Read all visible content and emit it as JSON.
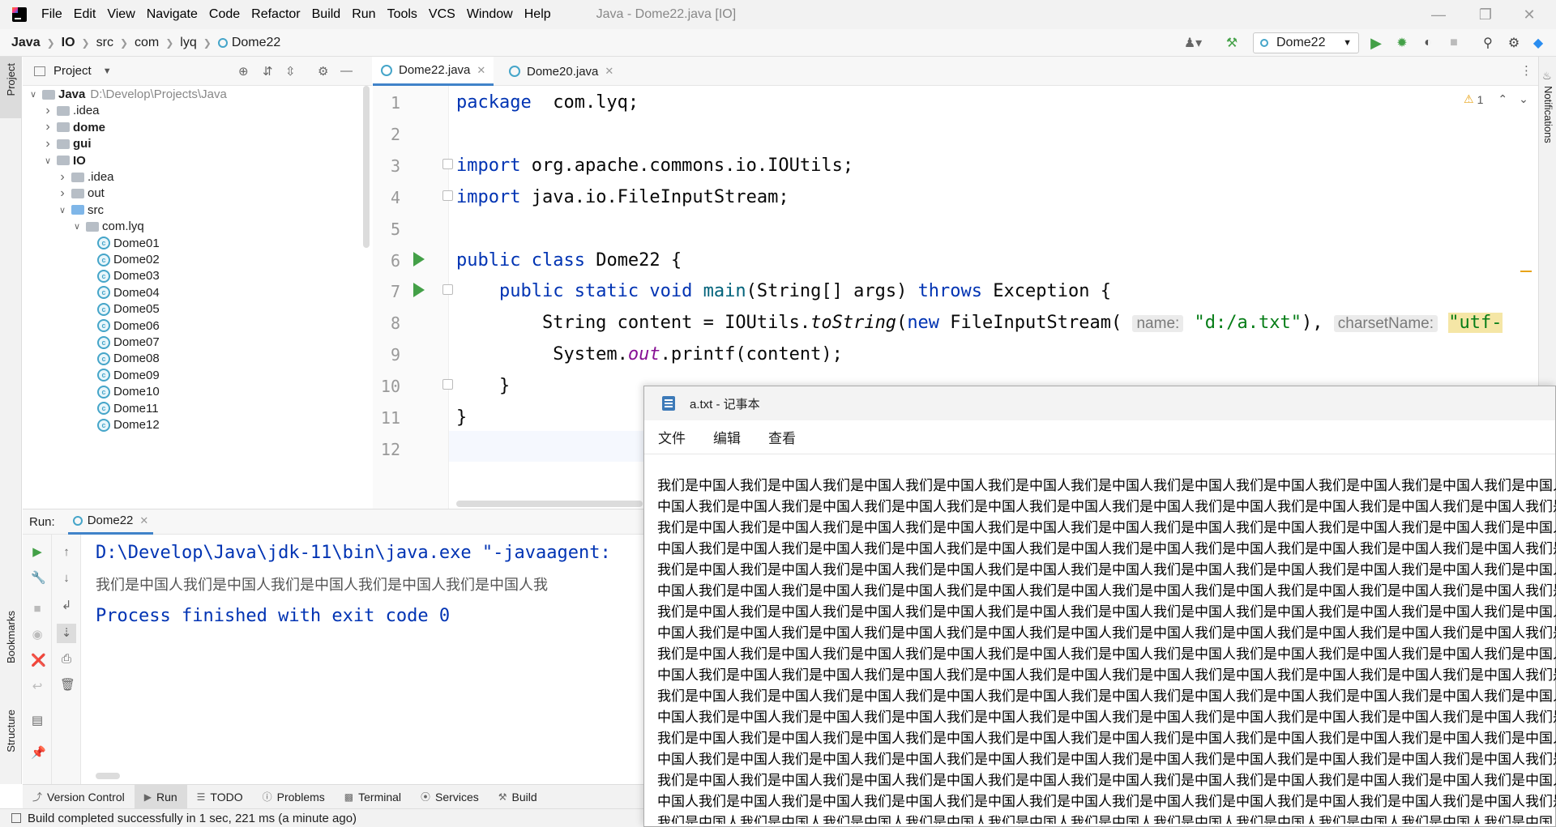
{
  "window": {
    "title": "Java - Dome22.java [IO]"
  },
  "menu": [
    "File",
    "Edit",
    "View",
    "Navigate",
    "Code",
    "Refactor",
    "Build",
    "Run",
    "Tools",
    "VCS",
    "Window",
    "Help"
  ],
  "breadcrumb": [
    "Java",
    "IO",
    "src",
    "com",
    "lyq",
    "Dome22"
  ],
  "run_config": "Dome22",
  "project_panel": {
    "title": "Project"
  },
  "tree": [
    {
      "label": "Java",
      "suffix": "D:\\Develop\\Projects\\Java",
      "depth": 0,
      "kind": "root",
      "open": true,
      "bold": true
    },
    {
      "label": ".idea",
      "depth": 1,
      "kind": "folder"
    },
    {
      "label": "dome",
      "depth": 1,
      "kind": "module",
      "bold": true
    },
    {
      "label": "gui",
      "depth": 1,
      "kind": "module",
      "bold": true
    },
    {
      "label": "IO",
      "depth": 1,
      "kind": "module",
      "open": true,
      "bold": true
    },
    {
      "label": ".idea",
      "depth": 2,
      "kind": "folder"
    },
    {
      "label": "out",
      "depth": 2,
      "kind": "folder"
    },
    {
      "label": "src",
      "depth": 2,
      "kind": "src",
      "open": true
    },
    {
      "label": "com.lyq",
      "depth": 3,
      "kind": "package",
      "open": true
    },
    {
      "label": "Dome01",
      "depth": 4,
      "kind": "class"
    },
    {
      "label": "Dome02",
      "depth": 4,
      "kind": "class"
    },
    {
      "label": "Dome03",
      "depth": 4,
      "kind": "class"
    },
    {
      "label": "Dome04",
      "depth": 4,
      "kind": "class"
    },
    {
      "label": "Dome05",
      "depth": 4,
      "kind": "class"
    },
    {
      "label": "Dome06",
      "depth": 4,
      "kind": "class"
    },
    {
      "label": "Dome07",
      "depth": 4,
      "kind": "class"
    },
    {
      "label": "Dome08",
      "depth": 4,
      "kind": "class"
    },
    {
      "label": "Dome09",
      "depth": 4,
      "kind": "class"
    },
    {
      "label": "Dome10",
      "depth": 4,
      "kind": "class"
    },
    {
      "label": "Dome11",
      "depth": 4,
      "kind": "class"
    },
    {
      "label": "Dome12",
      "depth": 4,
      "kind": "class"
    }
  ],
  "editor_tabs": [
    {
      "label": "Dome22.java",
      "active": true
    },
    {
      "label": "Dome20.java",
      "active": false
    }
  ],
  "editor": {
    "warnings": "1",
    "line_numbers": [
      "1",
      "2",
      "3",
      "4",
      "5",
      "6",
      "7",
      "8",
      "9",
      "10",
      "11",
      "12"
    ],
    "lines": [
      {
        "tokens": [
          [
            "kw",
            "package"
          ],
          [
            "",
            "  com.lyq;"
          ]
        ]
      },
      {
        "tokens": []
      },
      {
        "tokens": [
          [
            "kw",
            "import"
          ],
          [
            "",
            " org.apache.commons.io.IOUtils;"
          ]
        ]
      },
      {
        "tokens": [
          [
            "kw",
            "import"
          ],
          [
            "",
            " java.io.FileInputStream;"
          ]
        ]
      },
      {
        "tokens": []
      },
      {
        "tokens": [
          [
            "kw",
            "public class"
          ],
          [
            "",
            " Dome22 {"
          ]
        ]
      },
      {
        "tokens": [
          [
            "",
            "    "
          ],
          [
            "kw",
            "public static void"
          ],
          [
            "",
            " "
          ],
          [
            "fn",
            "main"
          ],
          [
            "",
            "(String[] args) "
          ],
          [
            "kw",
            "throws"
          ],
          [
            "",
            " Exception {"
          ]
        ]
      },
      {
        "tokens": [
          [
            "",
            "        String content = IOUtils."
          ],
          [
            "it",
            "toString"
          ],
          [
            "",
            "("
          ],
          [
            "kw",
            "new"
          ],
          [
            "",
            " FileInputStream( "
          ],
          [
            "hint",
            "name:"
          ],
          [
            "",
            " "
          ],
          [
            "str",
            "\"d:/a.txt\""
          ],
          [
            "",
            "), "
          ],
          [
            "hint",
            "charsetName:"
          ],
          [
            "",
            " "
          ],
          [
            "strhl",
            "\"utf-"
          ]
        ]
      },
      {
        "tokens": [
          [
            "",
            "         System."
          ],
          [
            "itp",
            "out"
          ],
          [
            "",
            ".printf(content);"
          ]
        ]
      },
      {
        "tokens": [
          [
            "",
            "    }"
          ]
        ]
      },
      {
        "tokens": [
          [
            "",
            "}"
          ]
        ]
      },
      {
        "tokens": []
      }
    ]
  },
  "run_panel": {
    "label": "Run:",
    "tab": "Dome22",
    "console": [
      "D:\\Develop\\Java\\jdk-11\\bin\\java.exe \"-javaagent:",
      "我们是中国人我们是中国人我们是中国人我们是中国人我们是中国人我",
      "Process finished with exit code 0"
    ]
  },
  "bottom_tabs": [
    "Version Control",
    "Run",
    "TODO",
    "Problems",
    "Terminal",
    "Services",
    "Build"
  ],
  "left_strip": [
    "Project",
    "Bookmarks",
    "Structure"
  ],
  "right_strip": [
    "Notifications"
  ],
  "status": "Build completed successfully in 1 sec, 221 ms (a minute ago)",
  "notepad": {
    "title": "a.txt - 记事本",
    "menu": [
      "文件",
      "编辑",
      "查看"
    ],
    "lines": [
      "我们是中国人我们是中国人我们是中国人我们是中国人我们是中国人我们是中国人我们是中国人我们是中国人我们是中国人我们是中国人我们是中国人我们是中国人我们是中国人我们是中国人我们是中国人我们是中国人我们是中国人我们是中国人我们是中国人我们是中国人我们是中国人我们是中国人我们是中国人我们是中国人",
      "中国人我们是中国人我们是中国人我们是中国人我们是中国人我们是中国人我们是中国人我们是中国人我们是中国人我们是中国人我们是中国人我们是中国人我们是中国人我们是中国人我们是中国人我们是中国人我们是中国人我们是中国人我们是中国人我们是中国人我们是中国人我们是中国人我们是中国人我们是中国人",
      "我们是中国人我们是中国人我们是中国人我们是中国人我们是中国人我们是中国人我们是中国人我们是中国人我们是中国人我们是中国人我们是中国人我们是中国人我们是中国人我们是中国人我们是中国人我们是中国人我们是中国人我们是中国人我们是中国人我们是中国人我们是中国人我们是中国人我们是中国人我们是中国人",
      "中国人我们是中国人我们是中国人我们是中国人我们是中国人我们是中国人我们是中国人我们是中国人我们是中国人我们是中国人我们是中国人我们是中国人我们是中国人我们是中国人我们是中国人我们是中国人我们是中国人我们是中国人我们是中国人我们是中国人我们是中国人我们是中国人我们是中国人我们是中国人",
      "我们是中国人我们是中国人我们是中国人我们是中国人我们是中国人我们是中国人我们是中国人我们是中国人我们是中国人我们是中国人我们是中国人我们是中国人我们是中国人我们是中国人我们是中国人我们是中国人我们是中国人我们是中国人我们是中国人我们是中国人我们是中国人我们是中国人我们是中国人我们是中国人",
      "中国人我们是中国人我们是中国人我们是中国人我们是中国人我们是中国人我们是中国人我们是中国人我们是中国人我们是中国人我们是中国人我们是中国人我们是中国人我们是中国人我们是中国人我们是中国人我们是中国人我们是中国人我们是中国人我们是中国人我们是中国人我们是中国人我们是中国人我们是中国人",
      "我们是中国人我们是中国人我们是中国人我们是中国人我们是中国人我们是中国人我们是中国人我们是中国人我们是中国人我们是中国人我们是中国人我们是中国人我们是中国人我们是中国人我们是中国人我们是中国人我们是中国人我们是中国人我们是中国人我们是中国人我们是中国人我们是中国人我们是中国人我们是中国人",
      "中国人我们是中国人我们是中国人我们是中国人我们是中国人我们是中国人我们是中国人我们是中国人我们是中国人我们是中国人我们是中国人我们是中国人我们是中国人我们是中国人我们是中国人我们是中国人我们是中国人我们是中国人我们是中国人我们是中国人我们是中国人我们是中国人我们是中国人我们是中国人",
      "我们是中国人我们是中国人我们是中国人我们是中国人我们是中国人我们是中国人我们是中国人我们是中国人我们是中国人我们是中国人我们是中国人我们是中国人我们是中国人我们是中国人我们是中国人我们是中国人我们是中国人我们是中国人我们是中国人我们是中国人我们是中国人我们是中国人我们是中国人我们是中国人",
      "中国人我们是中国人我们是中国人我们是中国人我们是中国人我们是中国人我们是中国人我们是中国人我们是中国人我们是中国人我们是中国人我们是中国人我们是中国人我们是中国人我们是中国人我们是中国人我们是中国人我们是中国人我们是中国人我们是中国人我们是中国人我们是中国人我们是中国人我们是中国人",
      "我们是中国人我们是中国人我们是中国人我们是中国人我们是中国人我们是中国人我们是中国人我们是中国人我们是中国人我们是中国人我们是中国人我们是中国人我们是中国人我们是中国人我们是中国人我们是中国人我们是中国人我们是中国人我们是中国人我们是中国人我们是中国人我们是中国人我们是中国人我们是中国人",
      "中国人我们是中国人我们是中国人我们是中国人我们是中国人我们是中国人我们是中国人我们是中国人我们是中国人我们是中国人我们是中国人我们是中国人我们是中国人我们是中国人我们是中国人我们是中国人我们是中国人我们是中国人我们是中国人我们是中国人我们是中国人我们是中国人我们是中国人我们是中国人",
      "我们是中国人我们是中国人我们是中国人我们是中国人我们是中国人我们是中国人我们是中国人我们是中国人我们是中国人我们是中国人我们是中国人我们是中国人我们是中国人我们是中国人我们是中国人我们是中国人我们是中国人我们是中国人我们是中国人我们是中国人我们是中国人我们是中国人我们是中国人我们是中国人",
      "中国人我们是中国人我们是中国人我们是中国人我们是中国人我们是中国人我们是中国人我们是中国人我们是中国人我们是中国人我们是中国人我们是中国人我们是中国人我们是中国人我们是中国人我们是中国人我们是中国人我们是中国人我们是中国人我们是中国人我们是中国人我们是中国人我们是中国人我们是中国人",
      "我们是中国人我们是中国人我们是中国人我们是中国人我们是中国人我们是中国人我们是中国人我们是中国人我们是中国人我们是中国人我们是中国人我们是中国人我们是中国人我们是中国人我们是中国人我们是中国人我们是中国人我们是中国人我们是中国人我们是中国人我们是中国人我们是中国人我们是中国人我们是中国人",
      "中国人我们是中国人我们是中国人我们是中国人我们是中国人我们是中国人我们是中国人我们是中国人我们是中国人我们是中国人我们是中国人我们是中国人我们是中国人我们是中国人我们是中国人我们是中国人我们是中国人我们是中国人我们是中国人我们是中国人我们是中国人我们是中国人我们是中国人我们是中国人",
      "我们是中国人我们是中国人我们是中国人我们是中国人我们是中国人我们是中国人我们是中国人我们是中国人我们是中国人我们是中国人我们是中国人我们是中国人我们是中国人我们是中国人我们是中国人我们是中国人我们是中国人我们是中国人我们是中国人我们是中国人我们是中国人我们是中国人我们是中国人我们是中国人"
    ]
  },
  "colors": {
    "accent": "#4083c9",
    "keyword": "#0033b3",
    "string": "#067d17",
    "run_green": "#43a047"
  }
}
